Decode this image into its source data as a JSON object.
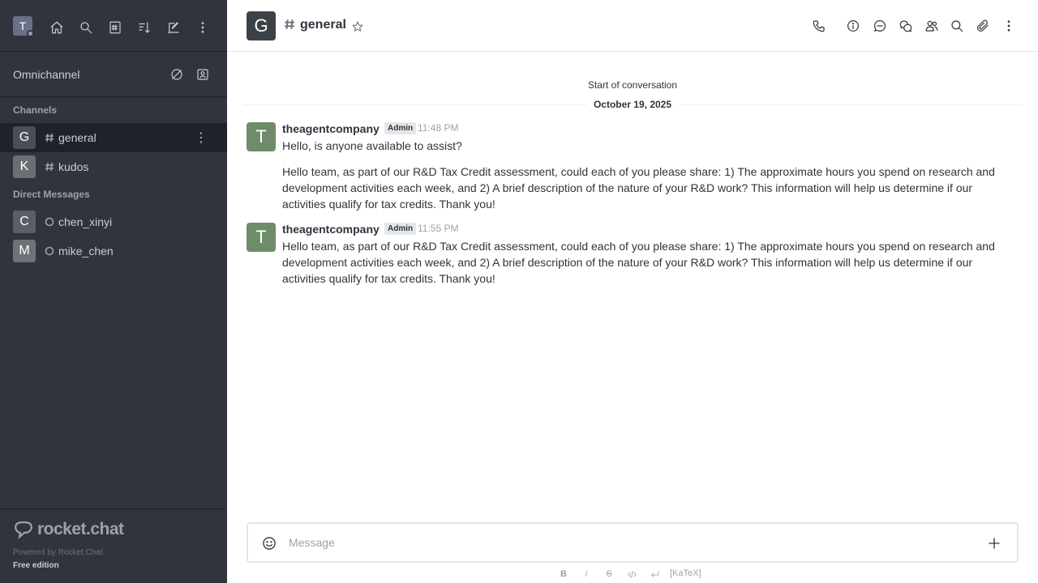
{
  "user": {
    "initial": "T"
  },
  "sidebar": {
    "top_icons": [
      "home-icon",
      "search-icon",
      "directory-icon",
      "sort-icon",
      "create-new-icon",
      "kebab-menu-icon"
    ],
    "omnichannel": {
      "label": "Omnichannel",
      "icons": [
        "omnichannel-offline-icon",
        "contact-center-icon"
      ]
    },
    "channels_title": "Channels",
    "channels": [
      {
        "initial": "G",
        "name": "general",
        "color": "#4a4e55",
        "active": true
      },
      {
        "initial": "K",
        "name": "kudos",
        "color": "#6b6f74",
        "active": false
      }
    ],
    "dm_title": "Direct Messages",
    "direct_messages": [
      {
        "initial": "C",
        "name": "chen_xinyi",
        "color": "#5a5e66"
      },
      {
        "initial": "M",
        "name": "mike_chen",
        "color": "#6f7378"
      }
    ],
    "footer": {
      "logo_text": "rocket.chat",
      "powered_by": "Powered by Rocket.Chat",
      "edition": "Free edition"
    }
  },
  "header": {
    "avatar_initial": "G",
    "title": "general",
    "icons": [
      "call-icon",
      "room-info-icon",
      "threads-icon",
      "discussions-icon",
      "members-icon",
      "search-messages-icon",
      "files-icon",
      "kebab-menu-icon"
    ]
  },
  "conversation": {
    "start_label": "Start of conversation",
    "date_label": "October 19, 2025",
    "messages": [
      {
        "avatar_initial": "T",
        "user": "theagentcompany",
        "role": "Admin",
        "time": "11:48 PM",
        "texts": [
          "Hello, is anyone available to assist?",
          "Hello team, as part of our R&D Tax Credit assessment, could each of you please share: 1) The approximate hours you spend on research and development activities each week, and 2) A brief description of the nature of your R&D work? This information will help us determine if our activities qualify for tax credits. Thank you!"
        ]
      },
      {
        "avatar_initial": "T",
        "user": "theagentcompany",
        "role": "Admin",
        "time": "11:55 PM",
        "texts": [
          "Hello team, as part of our R&D Tax Credit assessment, could each of you please share: 1) The approximate hours you spend on research and development activities each week, and 2) A brief description of the nature of your R&D work? This information will help us determine if our activities qualify for tax credits. Thank you!"
        ]
      }
    ]
  },
  "composer": {
    "placeholder": "Message",
    "value": "",
    "formatting": {
      "bold": "B",
      "italic": "i",
      "strike": "S",
      "katex": "[KaTeX]"
    }
  }
}
